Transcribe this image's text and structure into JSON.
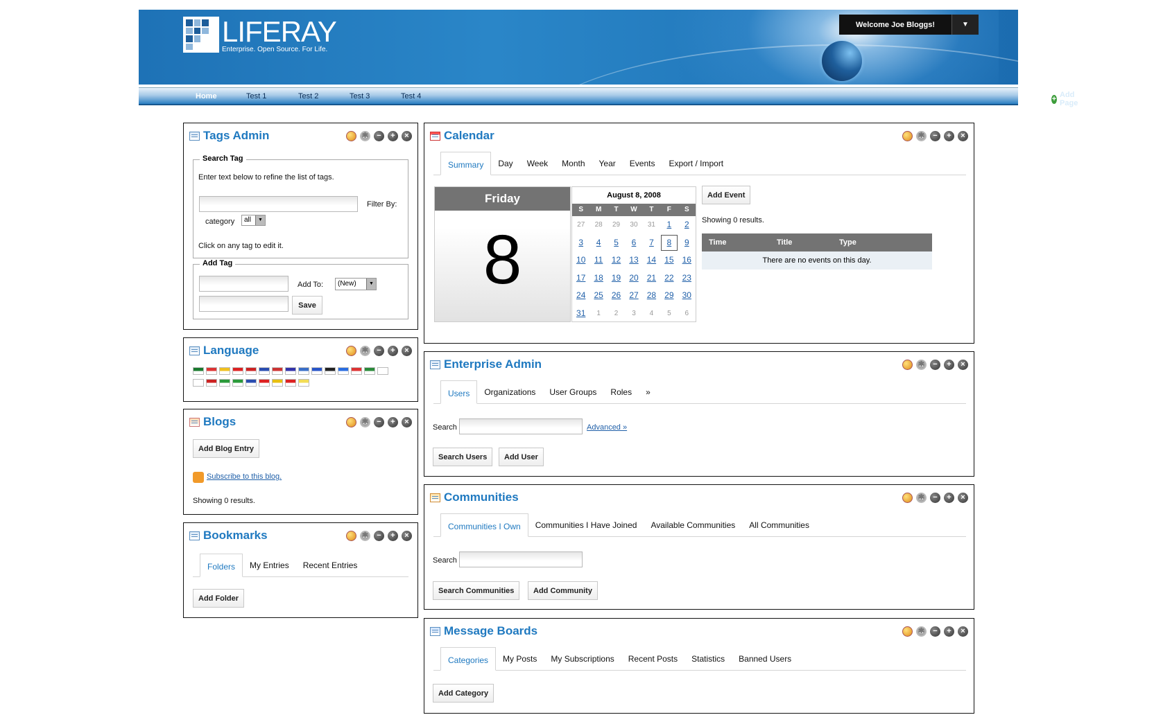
{
  "header": {
    "logo_word": "LIFERAY",
    "logo_tagline": "Enterprise. Open Source. For Life.",
    "welcome": "Welcome Joe Bloggs!",
    "dropdown_glyph": "▼"
  },
  "nav": {
    "items": [
      "Home",
      "Test 1",
      "Test 2",
      "Test 3",
      "Test 4"
    ],
    "add_page": "Add Page"
  },
  "tags_admin": {
    "title": "Tags Admin",
    "search_legend": "Search Tag",
    "search_help": "Enter text below to refine the list of tags.",
    "filter_by": "Filter By:",
    "category_label": "category",
    "category_value": "all",
    "edit_help": "Click on any tag to edit it.",
    "add_legend": "Add Tag",
    "add_to": "Add To:",
    "add_to_value": "(New)",
    "save": "Save"
  },
  "language": {
    "title": "Language",
    "flags": [
      "#1a7a2e",
      "#d33",
      "#f0c020",
      "#d22",
      "#c22",
      "#2a4db0",
      "#c33",
      "#33a",
      "#3a6fc8",
      "#2855c8",
      "#222",
      "#2a6de0",
      "#d33",
      "#2a8a3a",
      "#fff",
      "#fff",
      "#c22",
      "#2a9a3a",
      "#2a9a3a",
      "#2a4db0",
      "#d22",
      "#e8c010",
      "#d22",
      "#f3dd55"
    ]
  },
  "blogs": {
    "title": "Blogs",
    "add_entry": "Add Blog Entry",
    "subscribe": "Subscribe to this blog.",
    "results": "Showing 0 results."
  },
  "bookmarks": {
    "title": "Bookmarks",
    "tabs": [
      "Folders",
      "My Entries",
      "Recent Entries"
    ],
    "add_folder": "Add Folder"
  },
  "calendar": {
    "title": "Calendar",
    "tabs": [
      "Summary",
      "Day",
      "Week",
      "Month",
      "Year",
      "Events",
      "Export / Import"
    ],
    "day_name": "Friday",
    "day_number": "8",
    "month_title": "August 8, 2008",
    "weekdays": [
      "S",
      "M",
      "T",
      "W",
      "T",
      "F",
      "S"
    ],
    "weeks": [
      [
        [
          "27",
          "o"
        ],
        [
          "28",
          "o"
        ],
        [
          "29",
          "o"
        ],
        [
          "30",
          "o"
        ],
        [
          "31",
          "o"
        ],
        [
          "1",
          "d"
        ],
        [
          "2",
          "d"
        ]
      ],
      [
        [
          "3",
          "d"
        ],
        [
          "4",
          "d"
        ],
        [
          "5",
          "d"
        ],
        [
          "6",
          "d"
        ],
        [
          "7",
          "d"
        ],
        [
          "8",
          "sel"
        ],
        [
          "9",
          "d"
        ]
      ],
      [
        [
          "10",
          "d"
        ],
        [
          "11",
          "d"
        ],
        [
          "12",
          "d"
        ],
        [
          "13",
          "d"
        ],
        [
          "14",
          "d"
        ],
        [
          "15",
          "d"
        ],
        [
          "16",
          "d"
        ]
      ],
      [
        [
          "17",
          "d"
        ],
        [
          "18",
          "d"
        ],
        [
          "19",
          "d"
        ],
        [
          "20",
          "d"
        ],
        [
          "21",
          "d"
        ],
        [
          "22",
          "d"
        ],
        [
          "23",
          "d"
        ]
      ],
      [
        [
          "24",
          "d"
        ],
        [
          "25",
          "d"
        ],
        [
          "26",
          "d"
        ],
        [
          "27",
          "d"
        ],
        [
          "28",
          "d"
        ],
        [
          "29",
          "d"
        ],
        [
          "30",
          "d"
        ]
      ],
      [
        [
          "31",
          "d"
        ],
        [
          "1",
          "o"
        ],
        [
          "2",
          "o"
        ],
        [
          "3",
          "o"
        ],
        [
          "4",
          "o"
        ],
        [
          "5",
          "o"
        ],
        [
          "6",
          "o"
        ]
      ]
    ],
    "add_event": "Add Event",
    "results": "Showing 0 results.",
    "col_time": "Time",
    "col_title": "Title",
    "col_type": "Type",
    "no_events": "There are no events on this day."
  },
  "enterprise_admin": {
    "title": "Enterprise Admin",
    "tabs": [
      "Users",
      "Organizations",
      "User Groups",
      "Roles",
      "»"
    ],
    "search_label": "Search",
    "advanced": "Advanced »",
    "search_users": "Search Users",
    "add_user": "Add User"
  },
  "communities": {
    "title": "Communities",
    "tabs": [
      "Communities I Own",
      "Communities I Have Joined",
      "Available Communities",
      "All Communities"
    ],
    "search_label": "Search",
    "search_button": "Search Communities",
    "add_button": "Add Community"
  },
  "message_boards": {
    "title": "Message Boards",
    "tabs": [
      "Categories",
      "My Posts",
      "My Subscriptions",
      "Recent Posts",
      "Statistics",
      "Banned Users"
    ],
    "add_category": "Add Category"
  }
}
